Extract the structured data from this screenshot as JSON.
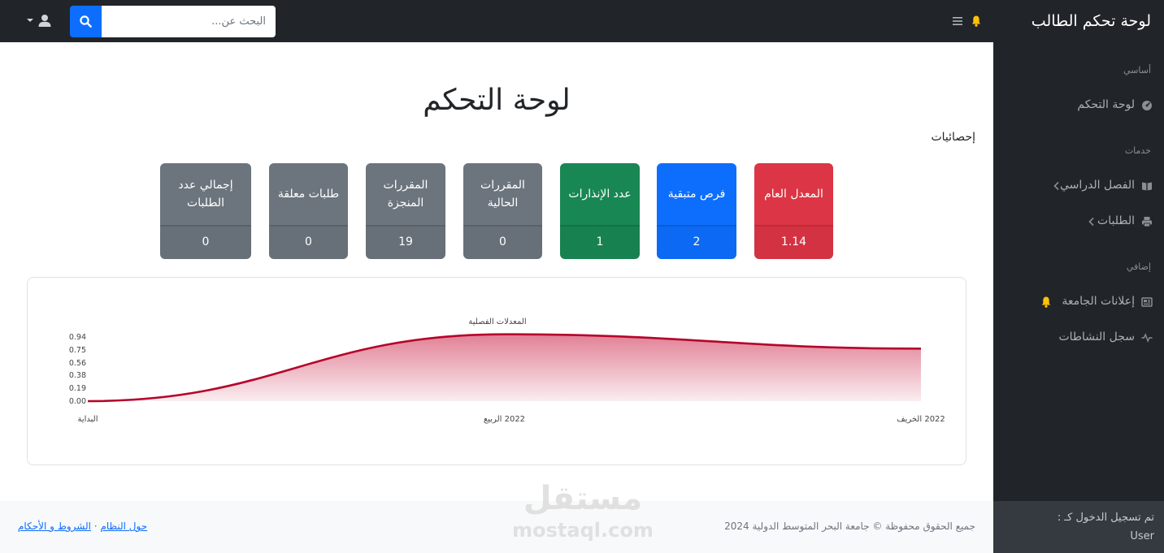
{
  "brand": "لوحة تحكم الطالب",
  "search": {
    "placeholder": "البحث عن..."
  },
  "sidebar": {
    "sections": [
      {
        "heading": "أساسي"
      },
      {
        "heading": "خدمات"
      },
      {
        "heading": "إضافي"
      }
    ],
    "items": [
      {
        "label": "لوحة التحكم",
        "icon": "dashboard-icon"
      },
      {
        "label": "الفصل الدراسي",
        "icon": "book-icon"
      },
      {
        "label": "الطلبات",
        "icon": "printer-icon"
      },
      {
        "label": "إعلانات الجامعة",
        "icon": "newspaper-icon"
      },
      {
        "label": "سجل النشاطات",
        "icon": "activity-icon"
      }
    ],
    "footer": {
      "logged_in_as": "تم تسجيل الدخول كـ :",
      "user": "User"
    }
  },
  "main": {
    "title": "لوحة التحكم",
    "stats_label": "إحصائيات"
  },
  "cards": [
    {
      "title": "المعدل العام",
      "value": "1.14",
      "color": "#dc3545"
    },
    {
      "title": "فرص متبقية",
      "value": "2",
      "color": "#0d6efd"
    },
    {
      "title": "عدد الإنذارات",
      "value": "1",
      "color": "#198754"
    },
    {
      "title": "المقررات الحالية",
      "value": "0",
      "color": "#6c757d"
    },
    {
      "title": "المقررات المنجزة",
      "value": "19",
      "color": "#6c757d"
    },
    {
      "title": "طلبات معلقة",
      "value": "0",
      "color": "#6c757d"
    },
    {
      "title": "إجمالي عدد الطلبات",
      "value": "0",
      "color": "#6c757d"
    }
  ],
  "chart_data": {
    "type": "area",
    "title": "المعدلات الفصلية",
    "categories": [
      "البداية",
      "2022 الربيع",
      "2022 الخريف"
    ],
    "values": [
      0.0,
      0.98,
      0.77
    ],
    "yticks": [
      "0.94",
      "0.75",
      "0.56",
      "0.38",
      "0.19",
      "0.00"
    ],
    "ylim": [
      0,
      0.94
    ],
    "line_color": "#b5042b",
    "fill_color": "#c8193f",
    "grid": false
  },
  "footer": {
    "copyright": "جميع الحقوق محفوظة © جامعة البحر المتوسط الدولية 2024",
    "links": [
      "حول النظام",
      "الشروط و الأحكام"
    ],
    "separator": "·"
  },
  "watermark": {
    "brand": "مستقل",
    "domain": "mostaql.com"
  }
}
